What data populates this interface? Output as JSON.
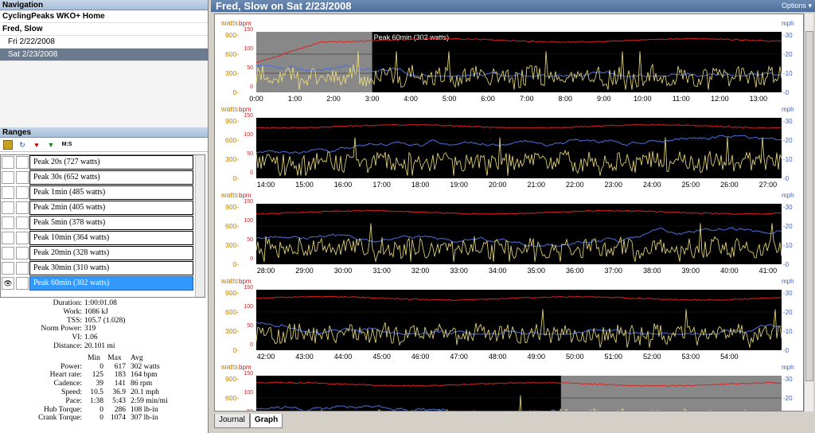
{
  "navigation": {
    "header": "Navigation",
    "items": [
      {
        "label": "CyclingPeaks WKO+ Home",
        "style": "bold"
      },
      {
        "label": "Fred, Slow",
        "style": "bold"
      },
      {
        "label": "Fri 2/22/2008",
        "style": "indent"
      },
      {
        "label": "Sat 2/23/2008",
        "style": "indent selected"
      }
    ]
  },
  "ranges": {
    "header": "Ranges",
    "tools": [
      "folder-icon",
      "refresh-icon",
      "marker-icon",
      "down-icon",
      "M:S"
    ],
    "items": [
      {
        "label": "Peak 20s (727 watts)",
        "selected": false
      },
      {
        "label": "Peak 30s (652 watts)",
        "selected": false
      },
      {
        "label": "Peak 1min (485 watts)",
        "selected": false
      },
      {
        "label": "Peak 2min (405 watts)",
        "selected": false
      },
      {
        "label": "Peak 5min (378 watts)",
        "selected": false
      },
      {
        "label": "Peak 10min (364 watts)",
        "selected": false
      },
      {
        "label": "Peak 20min (328 watts)",
        "selected": false
      },
      {
        "label": "Peak 30min (310 watts)",
        "selected": false
      },
      {
        "label": "Peak 60min (302 watts)",
        "selected": true
      }
    ]
  },
  "summary": [
    {
      "label": "Duration:",
      "value": "1:00:01.08"
    },
    {
      "label": "Work:",
      "value": "1086 kJ"
    },
    {
      "label": "TSS:",
      "value": "105.7 (1.028)"
    },
    {
      "label": "Norm Power:",
      "value": "319"
    },
    {
      "label": "VI:",
      "value": "1.06"
    },
    {
      "label": "Distance:",
      "value": "20.101 mi"
    }
  ],
  "metrics_table": {
    "headers": [
      "",
      "Min",
      "Max",
      "Avg"
    ],
    "rows": [
      [
        "Power:",
        "0",
        "617",
        "302 watts"
      ],
      [
        "Heart rate:",
        "125",
        "183",
        "164 bpm"
      ],
      [
        "Cadence:",
        "39",
        "141",
        "86 rpm"
      ],
      [
        "Speed:",
        "10.5",
        "36.9",
        "20.1 mph"
      ],
      [
        "Pace:",
        "1:38",
        "5:43",
        "2:59 min/mi"
      ],
      [
        "Hub Torque:",
        "0",
        "286",
        "108 lb-in"
      ],
      [
        "Crank Torque:",
        "0",
        "1074",
        "307 lb-in"
      ]
    ]
  },
  "main": {
    "title": "Fred, Slow on Sat 2/23/2008",
    "options_label": "Options",
    "highlight_label": "Peak 60min (302 watts)",
    "tabs": [
      {
        "label": "Journal",
        "active": false
      },
      {
        "label": "Graph",
        "active": true
      }
    ],
    "axis": {
      "left_units": "watts",
      "left_units2": "bpm",
      "right_units": "mph",
      "left_ticks": [
        "900-",
        "600-",
        "300-",
        "0-"
      ],
      "bpm_ticks": [
        "150",
        "100",
        "50",
        "0"
      ],
      "right_ticks": [
        "-30",
        "-20",
        "-10",
        "-0"
      ]
    },
    "rows": [
      {
        "ticks": [
          "0:00",
          "1:00",
          "2:00",
          "3:00",
          "4:00",
          "5:00",
          "6:00",
          "7:00",
          "8:00",
          "9:00",
          "10:00",
          "11:00",
          "12:00",
          "13:00"
        ],
        "highlight_start": 0,
        "highlight_end": 3
      },
      {
        "ticks": [
          "14:00",
          "15:00",
          "16:00",
          "17:00",
          "18:00",
          "19:00",
          "20:00",
          "21:00",
          "22:00",
          "23:00",
          "24:00",
          "25:00",
          "26:00",
          "27:00"
        ]
      },
      {
        "ticks": [
          "28:00",
          "29:00",
          "30:00",
          "31:00",
          "32:00",
          "33:00",
          "34:00",
          "35:00",
          "36:00",
          "37:00",
          "38:00",
          "39:00",
          "40:00",
          "41:00"
        ]
      },
      {
        "ticks": [
          "42:00",
          "43:00",
          "44:00",
          "45:00",
          "46:00",
          "47:00",
          "48:00",
          "49:00",
          "50:00",
          "51:00",
          "52:00",
          "53:00",
          "54:00"
        ]
      },
      {
        "ticks": [],
        "highlight_from_frac": 0.58
      }
    ]
  },
  "colors": {
    "power": "#f2e27a",
    "hr": "#e02020",
    "speed": "#4a6ee0",
    "bg": "#000000",
    "highlight": "#a0a0a0"
  }
}
